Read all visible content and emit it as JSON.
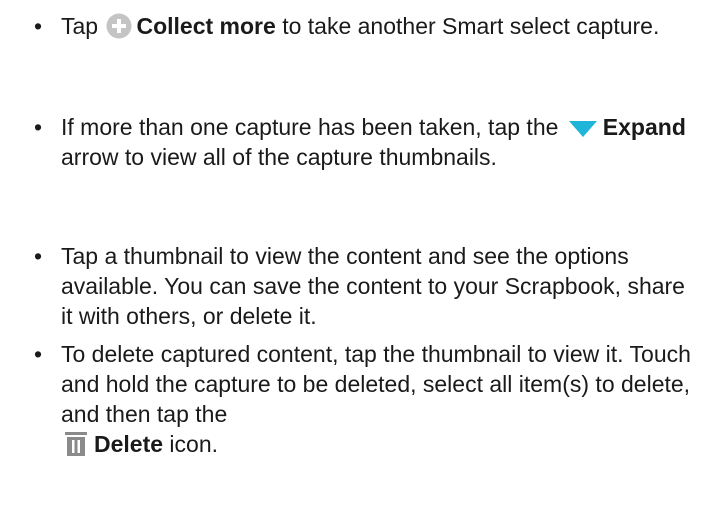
{
  "bullets": [
    {
      "before": "Tap ",
      "icon": "plus-circle-icon",
      "bold": "Collect more",
      "after": " to take another Smart select capture."
    },
    {
      "before": "If more than one capture has been taken, tap the ",
      "icon": "expand-arrow-icon",
      "bold": "Expand",
      "after": " arrow to view all of the capture thumbnails."
    },
    {
      "text": "Tap a thumbnail to view the content and see the options available. You can save the content to your Scrapbook, share it with others, or delete it."
    },
    {
      "before": "To delete captured content, tap the thumbnail to view it. Touch and hold the capture to be deleted, select all item(s) to delete, and then tap the",
      "icon": "trash-icon",
      "bold": "Delete",
      "after": " icon."
    }
  ],
  "bullet_char": "•",
  "colors": {
    "text": "#1a1a1a",
    "plus_icon": "#c4c4c4",
    "expand_icon": "#1fb5d8",
    "trash_icon": "#8a8a8a"
  }
}
